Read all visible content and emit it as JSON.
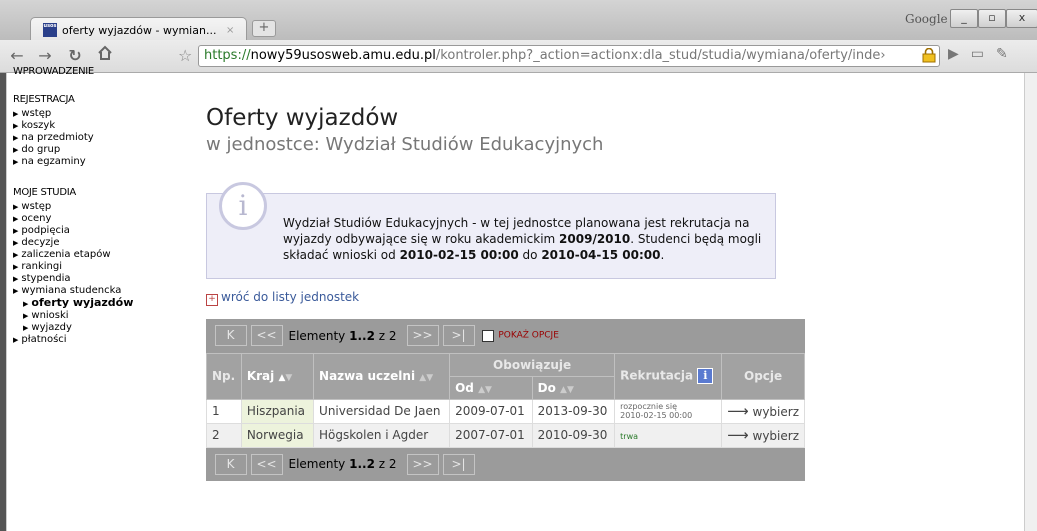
{
  "browser": {
    "tab_title": "oferty wyjazdów - wymian...",
    "tab_close": "×",
    "new_tab": "+",
    "favicon_text": "usos",
    "search_brand": "Google",
    "window_buttons": [
      "_",
      "▫",
      "x"
    ],
    "url_scheme": "https://",
    "url_host": "nowy59usosweb.amu.edu.pl",
    "url_path": "/kontroler.php?_action=actionx:dla_stud/studia/wymiana/oferty/inde›"
  },
  "menu": {
    "intro": "WPROWADZENIE",
    "sections": [
      {
        "title": "REJESTRACJA",
        "items": [
          "wstęp",
          "koszyk",
          "na przedmioty",
          "do grup",
          "na egzaminy"
        ]
      },
      {
        "title": "MOJE STUDIA",
        "items": [
          "wstęp",
          "oceny",
          "podpięcia",
          "decyzje",
          "zaliczenia etapów",
          "rankingi",
          "stypendia",
          "wymiana studencka"
        ]
      }
    ],
    "wymiana_sub": [
      "oferty wyjazdów",
      "wnioski",
      "wyjazdy"
    ],
    "last": "płatności"
  },
  "page": {
    "title": "Oferty wyjazdów",
    "subtitle": "w jednostce: Wydział Studiów Edukacyjnych",
    "info_t1": "Wydział Studiów Edukacyjnych - w tej jednostce planowana jest rekrutacja na wyjazdy odbywające się w roku akademickim ",
    "info_year": "2009/2010",
    "info_t2": ". Studenci będą mogli składać wnioski od ",
    "info_from": "2010-02-15 00:00",
    "info_t3": " do ",
    "info_to": "2010-04-15 00:00",
    "info_t4": ".",
    "back_link": "wróć do listy jednostek"
  },
  "pager": {
    "first": "K",
    "prev": "<<",
    "label": "Elementy ",
    "range": "1..2",
    "of": " z 2",
    "next": ">>",
    "last": ">|",
    "show_options": "POKAŻ OPCJE"
  },
  "table": {
    "col_np": "Np.",
    "col_kraj": "Kraj",
    "col_uczelnia": "Nazwa uczelni",
    "col_obowiazuje": "Obowiązuje",
    "col_od": "Od",
    "col_do": "Do",
    "col_rekrutacja": "Rekrutacja",
    "col_opcje": "Opcje",
    "rows": [
      {
        "np": "1",
        "kraj": "Hiszpania",
        "uczelnia": "Universidad De Jaen",
        "od": "2009-07-01",
        "do": "2013-09-30",
        "rek1": "rozpocznie się",
        "rek2": "2010-02-15 00:00",
        "opcje": "wybierz"
      },
      {
        "np": "2",
        "kraj": "Norwegia",
        "uczelnia": "Högskolen i Agder",
        "od": "2007-07-01",
        "do": "2010-09-30",
        "rek1": "trwa",
        "rek2": "",
        "opcje": "wybierz"
      }
    ]
  }
}
